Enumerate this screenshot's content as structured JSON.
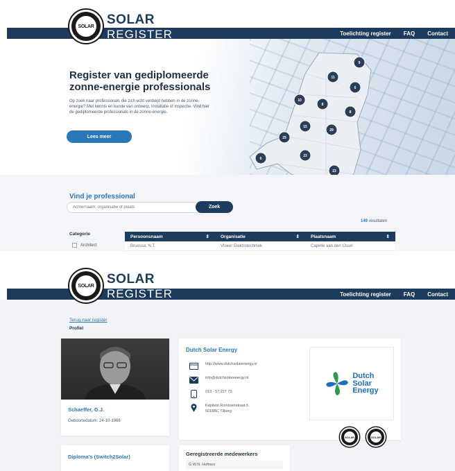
{
  "brand": {
    "line1": "SOLAR",
    "line2": "REGISTER",
    "badge_text": "SOLAR"
  },
  "nav": {
    "items": [
      "Toelichting register",
      "FAQ",
      "Contact"
    ]
  },
  "hero": {
    "title": "Register van gediplomeerde zonne-energie professionals",
    "intro": "Op zoek naar professionals die zich echt verdiept hebben in de zonne-energie? Met kennis en kunde van ontwerp, installatie of inspectie. Vind hier de gediplomeerde professionals in de zonne-energie.",
    "button": "Lees meer"
  },
  "map_markers": [
    "9",
    "11",
    "6",
    "10",
    "8",
    "8",
    "15",
    "29",
    "25",
    "6",
    "23",
    "23"
  ],
  "search": {
    "title": "Vind je professional",
    "placeholder": "Achternaam, organisatie of plaats",
    "button": "Zoek",
    "results_count": "149",
    "results_label": "resultaten"
  },
  "filter": {
    "heading": "Categorie",
    "first_option": "Architect"
  },
  "table": {
    "columns": [
      "Persoonsnaam",
      "Organisatie",
      "Plaatsnaam"
    ],
    "first_row": [
      "Bruessa, N.T.",
      "Vloeer Elektrotechniek",
      "Capelle aan den IJssel"
    ]
  },
  "profile": {
    "back_link": "Terug naar register",
    "breadcrumb": "Profiel",
    "name": "Schaeffer, G.J.",
    "birth_date": "Geboortedatum: 24-10-1966",
    "diplomas_title": "Diploma's (Switch2Solar)",
    "company": {
      "name": "Dutch Solar Energy",
      "website": "http://www.dutchsolarenergy.nl",
      "email": "info@dutchsolarenergy.nl",
      "phone": "013 - 57 227 73",
      "address_line1": "Kapitein Rondoenstraat 5",
      "address_line2": "5018BC Tilburg",
      "logo_line1": "Dutch",
      "logo_line2": "Solar",
      "logo_line3": "Energy"
    },
    "staff_title": "Geregistreerde medewerkers",
    "staff_first": "G.W.N. Hofmes"
  },
  "colors": {
    "navy": "#1d3b5c",
    "blue": "#2a78b8",
    "light_bg": "#f3f5f8"
  }
}
